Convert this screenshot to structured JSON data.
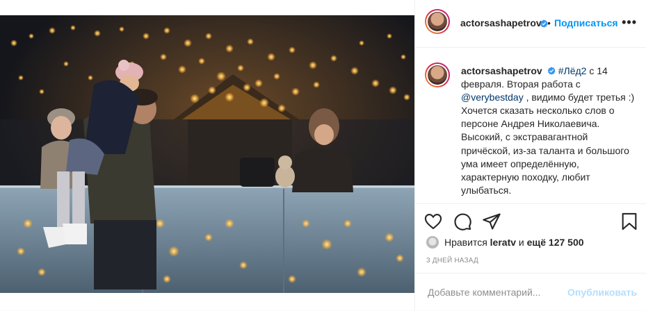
{
  "post": {
    "author": {
      "username": "actorsashapetrov",
      "verified": true
    },
    "follow_label": "Подписаться",
    "more_label": "•••",
    "caption": {
      "username": "actorsashapetrov",
      "hashtag": "#Лёд2",
      "text_before_mention": " с 14 февраля. Вторая работа с ",
      "mention": "@verybestday",
      "text_after_mention": " , видимо будет третья :) Хочется сказать несколько слов о персоне Андрея Николаевича. Высокий, с экстравагантной причёской, из-за таланта и большого ума имеет определённую, характерную походку, любит улыбаться."
    },
    "likes": {
      "prefix": "Нравится",
      "liked_by": "leratv",
      "and_label": "и",
      "others": "ещё 127 500"
    },
    "time_ago": "3 дней назад",
    "comment": {
      "placeholder": "Добавьте комментарий...",
      "value": "",
      "publish_label": "Опубликовать"
    }
  },
  "icons": {
    "like": "heart-icon",
    "comment": "comment-bubble-icon",
    "share": "paper-plane-icon",
    "save": "bookmark-icon",
    "verified": "verified-badge-icon"
  },
  "colors": {
    "accent": "#0095f6",
    "link": "#00376b",
    "muted": "#8e8e8e",
    "publish_disabled": "#b2dffc",
    "verified": "#3897f0"
  }
}
